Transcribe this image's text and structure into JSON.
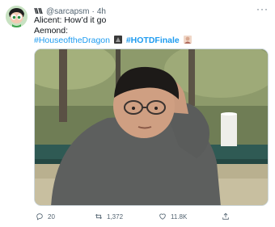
{
  "tweet": {
    "handle": "@sarcapsm",
    "separator": "·",
    "time": "4h",
    "badge_icon": "puppet-icon",
    "more_icon": "···",
    "lines": {
      "line1": "Alicent: How’d it go",
      "line2": "Aemond:"
    },
    "hashtags": {
      "first": "#HouseoftheDragon",
      "second": "#HOTDFinale"
    },
    "media": {
      "type": "meme-photo"
    },
    "actions": {
      "replies": "20",
      "retweets": "1,372",
      "likes": "11.8K"
    }
  }
}
